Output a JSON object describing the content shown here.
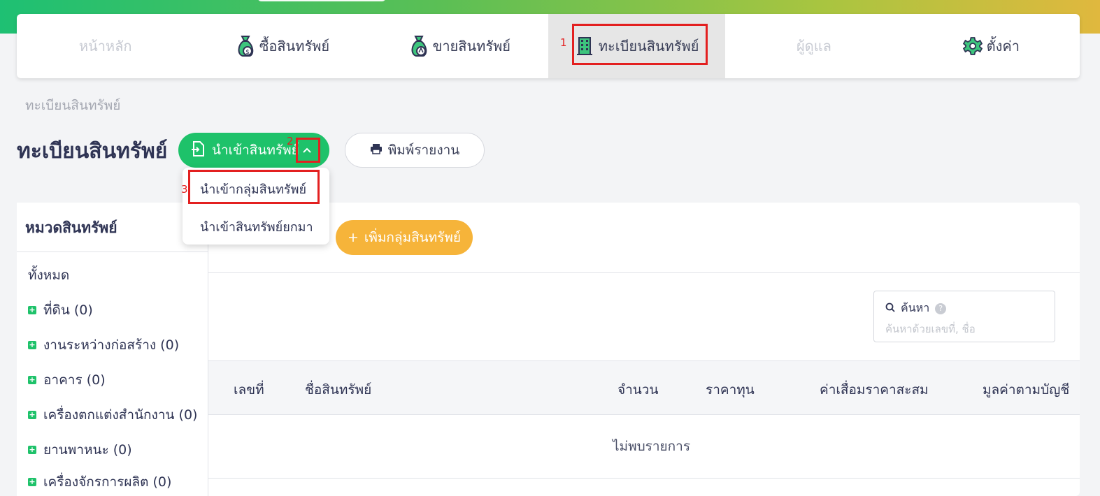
{
  "nav": {
    "items": [
      {
        "label": "หน้าหลัก",
        "icon": "home",
        "state": "disabled"
      },
      {
        "label": "ซื้อสินทรัพย์",
        "icon": "money-bag-icon",
        "state": "normal"
      },
      {
        "label": "ขายสินทรัพย์",
        "icon": "money-bag-icon",
        "state": "normal"
      },
      {
        "label": "ทะเบียนสินทรัพย์",
        "icon": "building-icon",
        "state": "active"
      },
      {
        "label": "ผู้ดูแล",
        "icon": "user",
        "state": "disabled"
      },
      {
        "label": "ตั้งค่า",
        "icon": "gear-icon",
        "state": "normal"
      }
    ]
  },
  "annotations": [
    "1",
    "2",
    "3"
  ],
  "breadcrumb": "ทะเบียนสินทรัพย์",
  "page_title": "ทะเบียนสินทรัพย์",
  "buttons": {
    "import": "นำเข้าสินทรัพย์",
    "print": "พิมพ์รายงาน",
    "add_group": "เพิ่มกลุ่มสินทรัพย์",
    "add_group_prefix": "+"
  },
  "dropdown": {
    "items": [
      "นำเข้ากลุ่มสินทรัพย์",
      "นำเข้าสินทรัพย์ยกมา"
    ]
  },
  "sidebar": {
    "title": "หมวดสินทรัพย์",
    "all_label": "ทั้งหมด",
    "categories": [
      "ที่ดิน (0)",
      "งานระหว่างก่อสร้าง (0)",
      "อาคาร (0)",
      "เครื่องตกแต่งสำนักงาน (0)",
      "ยานพาหนะ (0)",
      "เครื่องจักรการผลิต (0)"
    ]
  },
  "search": {
    "label": "ค้นหา",
    "help": "?",
    "placeholder": "ค้นหาด้วยเลขที่, ชื่อ"
  },
  "table": {
    "headers": [
      "เลขที่",
      "ชื่อสินทรัพย์",
      "จำนวน",
      "ราคาทุน",
      "ค่าเสื่อมราคาสะสม",
      "มูลค่าตามบัญชี"
    ],
    "empty_text": "ไม่พบรายการ"
  },
  "colors": {
    "primary_green": "#1ec26a",
    "accent_orange": "#f6b43a",
    "highlight_red": "#e32020"
  }
}
